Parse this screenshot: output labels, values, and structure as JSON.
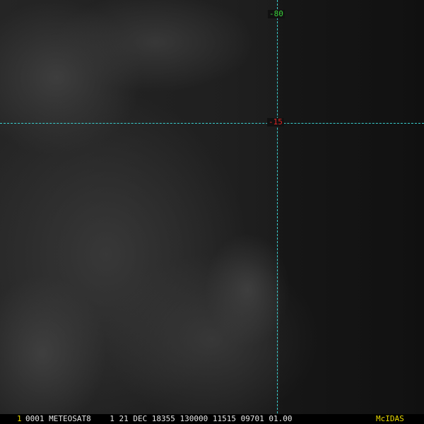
{
  "overlay": {
    "longitude_label": "-80",
    "latitude_label": "-15",
    "longitude_color": "#3ad13a",
    "latitude_color": "#e02424",
    "grid_color": "#39d0d0"
  },
  "status_bar": {
    "frame_number": "1",
    "frame_number_color": "#e8d800",
    "text": "0001 METEOSAT8    1 21 DEC 18355 130000 11515 09701 01.00",
    "brand": "McIDAS",
    "brand_color": "#e8d800"
  }
}
